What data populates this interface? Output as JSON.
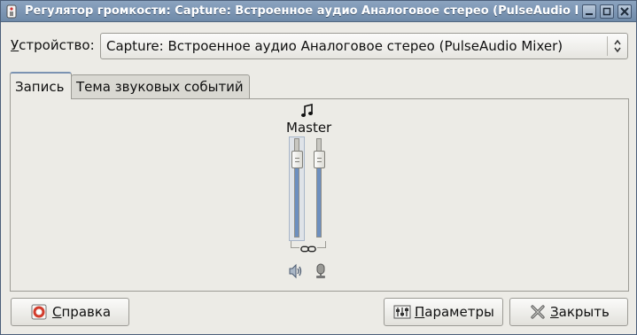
{
  "window": {
    "title": "Регулятор громкости: Capture: Встроенное аудио Аналоговое стерео (PulseAudio Mixer)",
    "titlebar_buttons": {
      "minimize_icon": "minimize-icon",
      "maximize_icon": "maximize-icon",
      "close_icon": "close-icon"
    }
  },
  "device": {
    "label_prefix": "У",
    "label_rest": "стройство:",
    "selected": "Capture: Встроенное аудио Аналоговое стерео (PulseAudio Mixer)"
  },
  "tabs": [
    {
      "label": "Запись",
      "active": true
    },
    {
      "label": "Тема звуковых событий",
      "active": false
    }
  ],
  "mixer": {
    "track_icon": "music-note-icon",
    "track_label": "Master",
    "channels": [
      {
        "name": "left",
        "level": 0.78
      },
      {
        "name": "right",
        "level": 0.78
      }
    ],
    "locked": true,
    "speaker_icon": "speaker-icon",
    "record_icon": "microphone-icon"
  },
  "buttons": {
    "help": {
      "mnemonic": "С",
      "rest": "правка",
      "icon": "help-icon"
    },
    "params": {
      "mnemonic": "П",
      "rest": "араметры",
      "icon": "preferences-icon"
    },
    "close": {
      "mnemonic": "З",
      "rest": "акрыть",
      "icon": "close-x-icon"
    }
  },
  "colors": {
    "titlebar": "#7d97b5",
    "accent": "#6d8fbf",
    "background": "#ecebe6"
  }
}
